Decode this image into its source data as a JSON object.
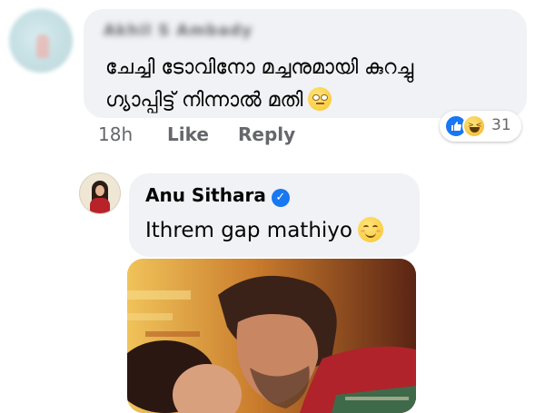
{
  "comment": {
    "author_blurred": "Akhil S Ambady",
    "text_line1": "ചേച്ചി ടോവിനോ മച്ചനുമായി കുറച്ചു",
    "text_line2": "ഗ്യാപ്പിട്ട് നിന്നാൽ മതി",
    "emoji": "face-with-rolling-eyes",
    "time": "18h",
    "like_label": "Like",
    "reply_label": "Reply",
    "reactions": {
      "types": [
        "like-icon",
        "haha-icon"
      ],
      "count": "31"
    }
  },
  "reply": {
    "author": "Anu Sithara",
    "verified": true,
    "text": "Ithrem gap mathiyo",
    "emoji": "smiling-face-with-smiling-eyes",
    "attachment": "photo"
  },
  "colors": {
    "bubble": "#f0f2f5",
    "meta": "#65676b",
    "accent": "#1877f2"
  }
}
